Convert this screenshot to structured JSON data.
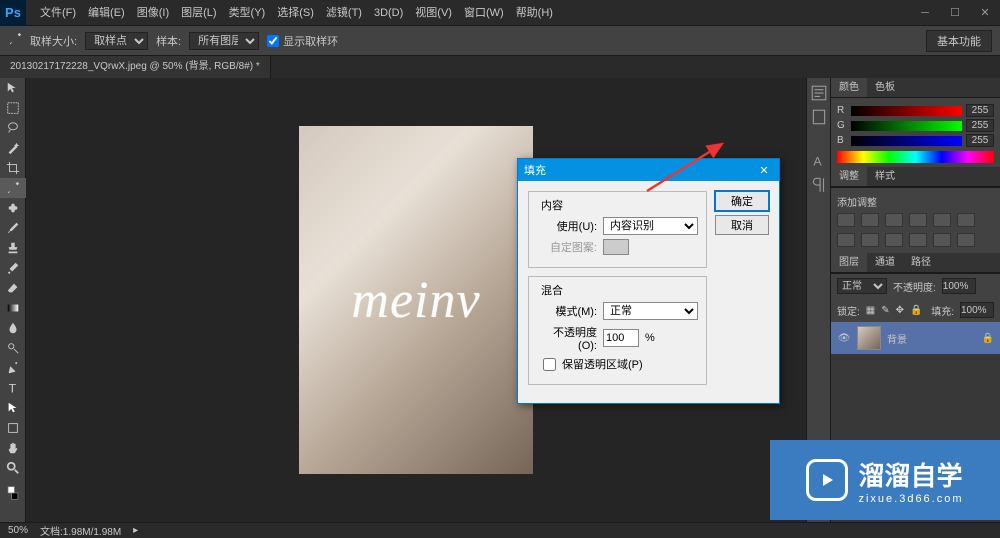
{
  "app": {
    "logo": "Ps"
  },
  "menu": [
    "文件(F)",
    "编辑(E)",
    "图像(I)",
    "图层(L)",
    "类型(Y)",
    "选择(S)",
    "滤镜(T)",
    "3D(D)",
    "视图(V)",
    "窗口(W)",
    "帮助(H)"
  ],
  "options": {
    "sample_size_label": "取样大小:",
    "sample_size_value": "取样点",
    "sample_label": "样本:",
    "sample_value": "所有图层",
    "show_ring_label": "显示取样环"
  },
  "workspace": "基本功能",
  "doc_tab": "20130217172228_VQrwX.jpeg @ 50% (背景, RGB/8#) *",
  "watermark": "meinv",
  "dialog": {
    "title": "填充",
    "ok": "确定",
    "cancel": "取消",
    "content_group": "内容",
    "use_label": "使用(U):",
    "use_value": "内容识别",
    "custom_pattern_label": "自定图案:",
    "blend_group": "混合",
    "mode_label": "模式(M):",
    "mode_value": "正常",
    "opacity_label": "不透明度(O):",
    "opacity_value": "100",
    "opacity_unit": "%",
    "preserve_label": "保留透明区域(P)"
  },
  "panels": {
    "color_tab": "颜色",
    "swatches_tab": "色板",
    "r": "R",
    "g": "G",
    "b": "B",
    "r_val": "255",
    "g_val": "255",
    "b_val": "255",
    "adjust_tab": "调整",
    "styles_tab": "样式",
    "add_adjust": "添加调整",
    "layers_tab": "图层",
    "channels_tab": "通道",
    "paths_tab": "路径",
    "blend_mode": "正常",
    "opacity_label": "不透明度:",
    "opacity_value": "100%",
    "lock_label": "锁定:",
    "fill_label": "填充:",
    "fill_value": "100%",
    "layer_name": "背景"
  },
  "status": {
    "zoom": "50%",
    "doc_info": "文档:1.98M/1.98M"
  },
  "site_logo": {
    "name": "溜溜自学",
    "sub": "zixue.3d66.com"
  }
}
